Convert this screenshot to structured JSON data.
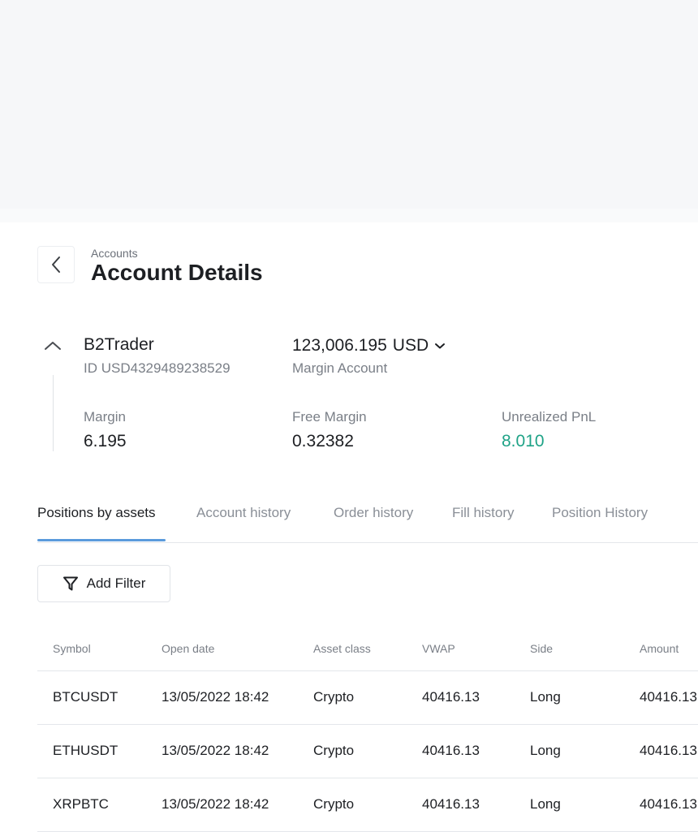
{
  "header": {
    "breadcrumb": "Accounts",
    "title": "Account Details",
    "back_icon": "chevron-left-icon"
  },
  "account": {
    "name": "B2Trader",
    "id": "ID USD4329489238529",
    "balance": "123,006.195",
    "currency": "USD",
    "type": "Margin Account",
    "collapse_icon": "chevron-up-icon"
  },
  "stats": [
    {
      "label": "Margin",
      "value": "6.195"
    },
    {
      "label": "Free Margin",
      "value": "0.32382"
    },
    {
      "label": "Unrealized PnL",
      "value": "8.010",
      "color": "#1fa387"
    }
  ],
  "tabs": [
    {
      "label": "Positions by assets",
      "active": true
    },
    {
      "label": "Account history"
    },
    {
      "label": "Order history"
    },
    {
      "label": "Fill history"
    },
    {
      "label": "Position History"
    }
  ],
  "filter": {
    "label": "Add Filter",
    "icon": "filter-icon"
  },
  "table": {
    "columns": [
      "Symbol",
      "Open date",
      "Asset class",
      "VWAP",
      "Side",
      "Amount"
    ],
    "rows": [
      [
        "BTCUSDT",
        "13/05/2022 18:42",
        "Crypto",
        "40416.13",
        "Long",
        "40416.13"
      ],
      [
        "ETHUSDT",
        "13/05/2022 18:42",
        "Crypto",
        "40416.13",
        "Long",
        "40416.13"
      ],
      [
        "XRPBTC",
        "13/05/2022 18:42",
        "Crypto",
        "40416.13",
        "Long",
        "40416.13"
      ]
    ]
  },
  "colors": {
    "accent": "#5b9bdc",
    "positive": "#1fa387"
  }
}
